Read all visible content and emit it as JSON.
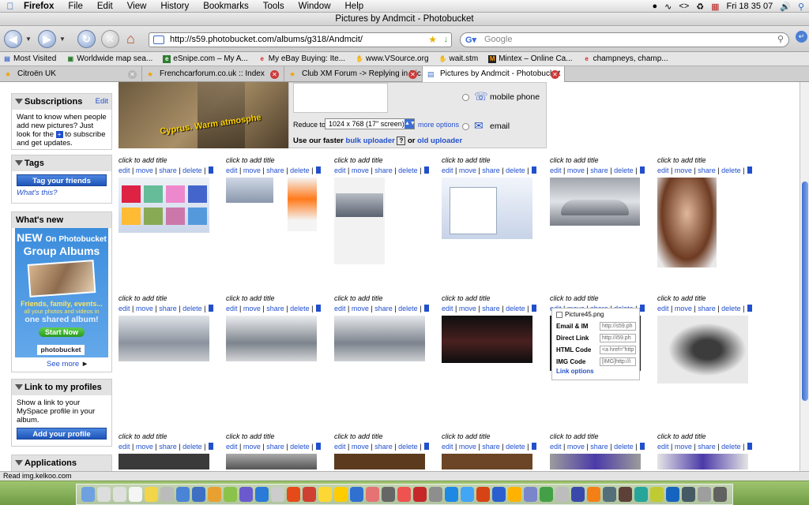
{
  "menubar": {
    "app": "Firefox",
    "items": [
      "File",
      "Edit",
      "View",
      "History",
      "Bookmarks",
      "Tools",
      "Window",
      "Help"
    ],
    "clock": "Fri 18 35 07"
  },
  "window": {
    "title": "Pictures by Andmcit - Photobucket"
  },
  "navbar": {
    "url": "http://s59.photobucket.com/albums/g318/Andmcit/",
    "search_placeholder": "Google"
  },
  "bookmarks": [
    {
      "label": "Most Visited",
      "icon": "most-visited-icon"
    },
    {
      "label": "Worldwide map sea...",
      "icon": "map-icon"
    },
    {
      "label": "eSnipe.com – My A...",
      "icon": "esnipe-icon"
    },
    {
      "label": "My eBay Buying: Ite...",
      "icon": "ebay-icon"
    },
    {
      "label": "www.VSource.org",
      "icon": "vsource-icon"
    },
    {
      "label": "wait.stm",
      "icon": "page-icon"
    },
    {
      "label": "Mintex – Online Ca...",
      "icon": "mintex-icon"
    },
    {
      "label": "champneys, champ...",
      "icon": "ebay-icon"
    }
  ],
  "tabs": [
    {
      "label": "Citroën UK",
      "active": false
    },
    {
      "label": "Frenchcarforum.co.uk :: Index",
      "active": false
    },
    {
      "label": "Club XM Forum -> Replying in Pic...",
      "active": false
    },
    {
      "label": "Pictures by Andmcit - Photobucket",
      "active": true
    }
  ],
  "sidebar": {
    "subscriptions": {
      "title": "Subscriptions",
      "edit": "Edit",
      "text_before": "Want to know when people add new pictures? Just look for the",
      "text_after": "to subscribe and get updates."
    },
    "tags": {
      "title": "Tags",
      "button": "Tag your friends",
      "link": "What's this?"
    },
    "whats_new": {
      "title": "What's new",
      "ad_line1": "NEW",
      "ad_line1b": "On Photobucket",
      "ad_line2": "Group Albums",
      "ad_line3": "Friends, family, events...",
      "ad_line4": "all your photos and videos in",
      "ad_line5": "one shared album!",
      "ad_button": "Start Now",
      "ad_brand": "photobucket",
      "see_more": "See more"
    },
    "profiles": {
      "title": "Link to my profiles",
      "text": "Show a link to your MySpace profile in your album.",
      "button": "Add your profile"
    },
    "applications": {
      "title": "Applications"
    }
  },
  "top_panel": {
    "hero_caption": "Cyprus. Warm atmosphe",
    "reduce_label": "Reduce to:",
    "reduce_value": "1024 x 768 (17\" screen)",
    "more_options": "more options",
    "uploader_text_a": "Use our faster",
    "uploader_link1": "bulk uploader",
    "uploader_text_b": "or",
    "uploader_link2": "old uploader",
    "help_badge": "?",
    "option_mobile": "mobile phone",
    "option_email": "email"
  },
  "photo": {
    "click_title": "click to add title",
    "actions": [
      "edit",
      "move",
      "share",
      "delete"
    ]
  },
  "rows": [
    [
      "screenshot-collage",
      "car-forum-screen",
      "orange-heart-ad",
      "photobucket-links-popup",
      "upload-page",
      "citroen-c6-car",
      "woman-portrait"
    ],
    [
      "silver-concept-car-rear",
      "silver-concept-car-side",
      "silver-concept-car-rear2",
      "black-ds-car",
      "citroen-logo-grille",
      "grey-plastic-part"
    ],
    [
      "dark-car-1",
      "dashboard",
      "brown-leather",
      "brown-leather2",
      "purple-spring",
      "purple-part"
    ]
  ],
  "popup": {
    "filename": "Picture45.png",
    "rows": [
      {
        "label": "Email & IM",
        "value": "http://s59.ph"
      },
      {
        "label": "Direct Link",
        "value": "http://i59.ph"
      },
      {
        "label": "HTML Code",
        "value": "<a href=\"http"
      },
      {
        "label": "IMG Code",
        "value": "[IMG]http://i"
      }
    ],
    "link_options": "Link options"
  },
  "statusbar": "Read img.kelkoo.com"
}
